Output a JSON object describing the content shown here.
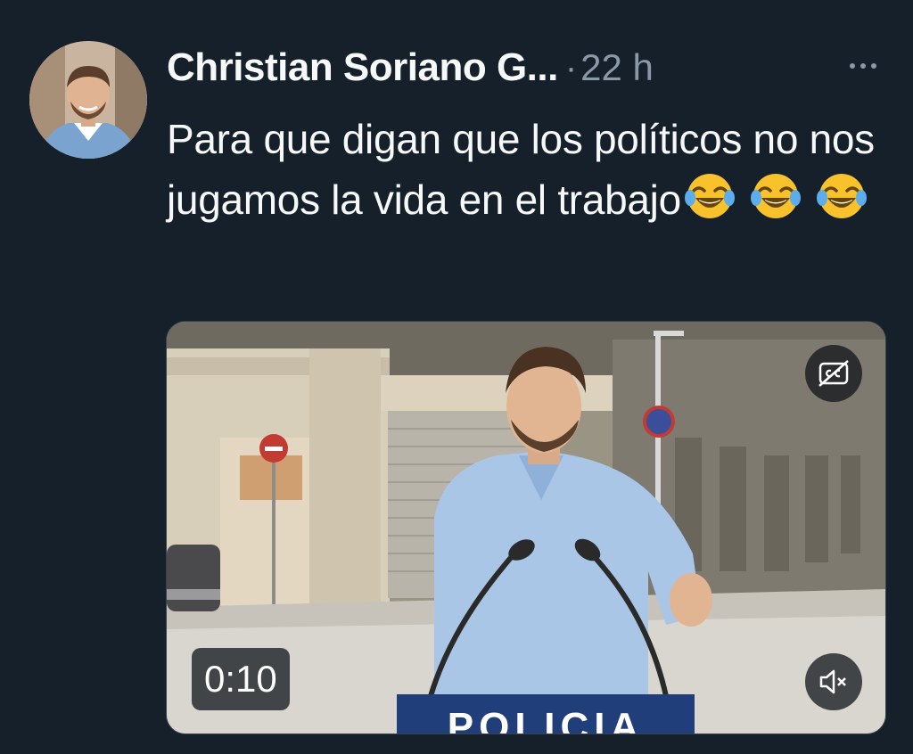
{
  "tweet": {
    "author_name": "Christian Soriano G...",
    "separator": "·",
    "timestamp": "22 h",
    "text": "Para que digan que los políticos no nos jugamos la vida en el trabajo",
    "emojis": [
      "😂",
      "😂",
      "😂"
    ]
  },
  "media": {
    "type": "video",
    "duration": "0:10",
    "podium_text": "POLICIA",
    "captions_icon": "captions-off-icon",
    "mute_icon": "volume-muted-icon"
  },
  "colors": {
    "background": "#15202b",
    "text_primary": "#f7f9f9",
    "text_secondary": "#8b98a5",
    "overlay": "#0f1419"
  }
}
